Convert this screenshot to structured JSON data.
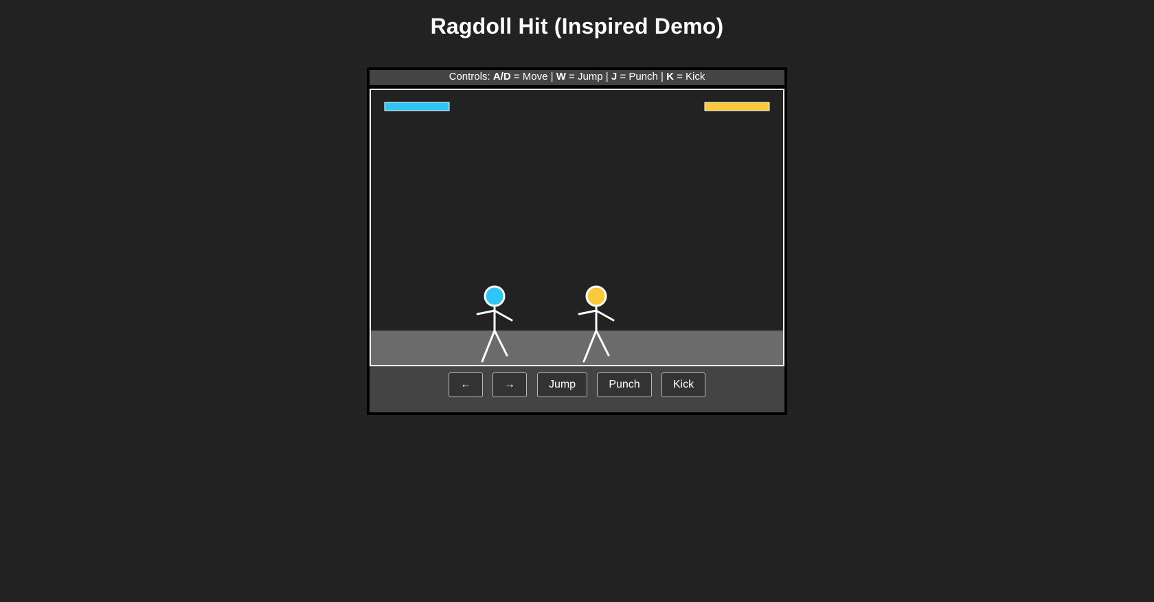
{
  "page": {
    "title": "Ragdoll Hit (Inspired Demo)"
  },
  "controls": {
    "prefix": "Controls: ",
    "move_key": "A/D",
    "move_text": " = Move | ",
    "jump_key": "W",
    "jump_text": " = Jump | ",
    "punch_key": "J",
    "punch_text": " = Punch | ",
    "kick_key": "K",
    "kick_text": " = Kick"
  },
  "buttons": {
    "left_label": "←",
    "right_label": "→",
    "jump_label": "Jump",
    "punch_label": "Punch",
    "kick_label": "Kick"
  },
  "players": [
    {
      "id": "player-1",
      "color": "#2ec6f7",
      "health": 1.0
    },
    {
      "id": "player-2",
      "color": "#fbc93a",
      "health": 1.0
    }
  ],
  "colors": {
    "background": "#222222",
    "ground": "#6b6b6b",
    "stick": "#ffffff",
    "bar": "#444444"
  }
}
